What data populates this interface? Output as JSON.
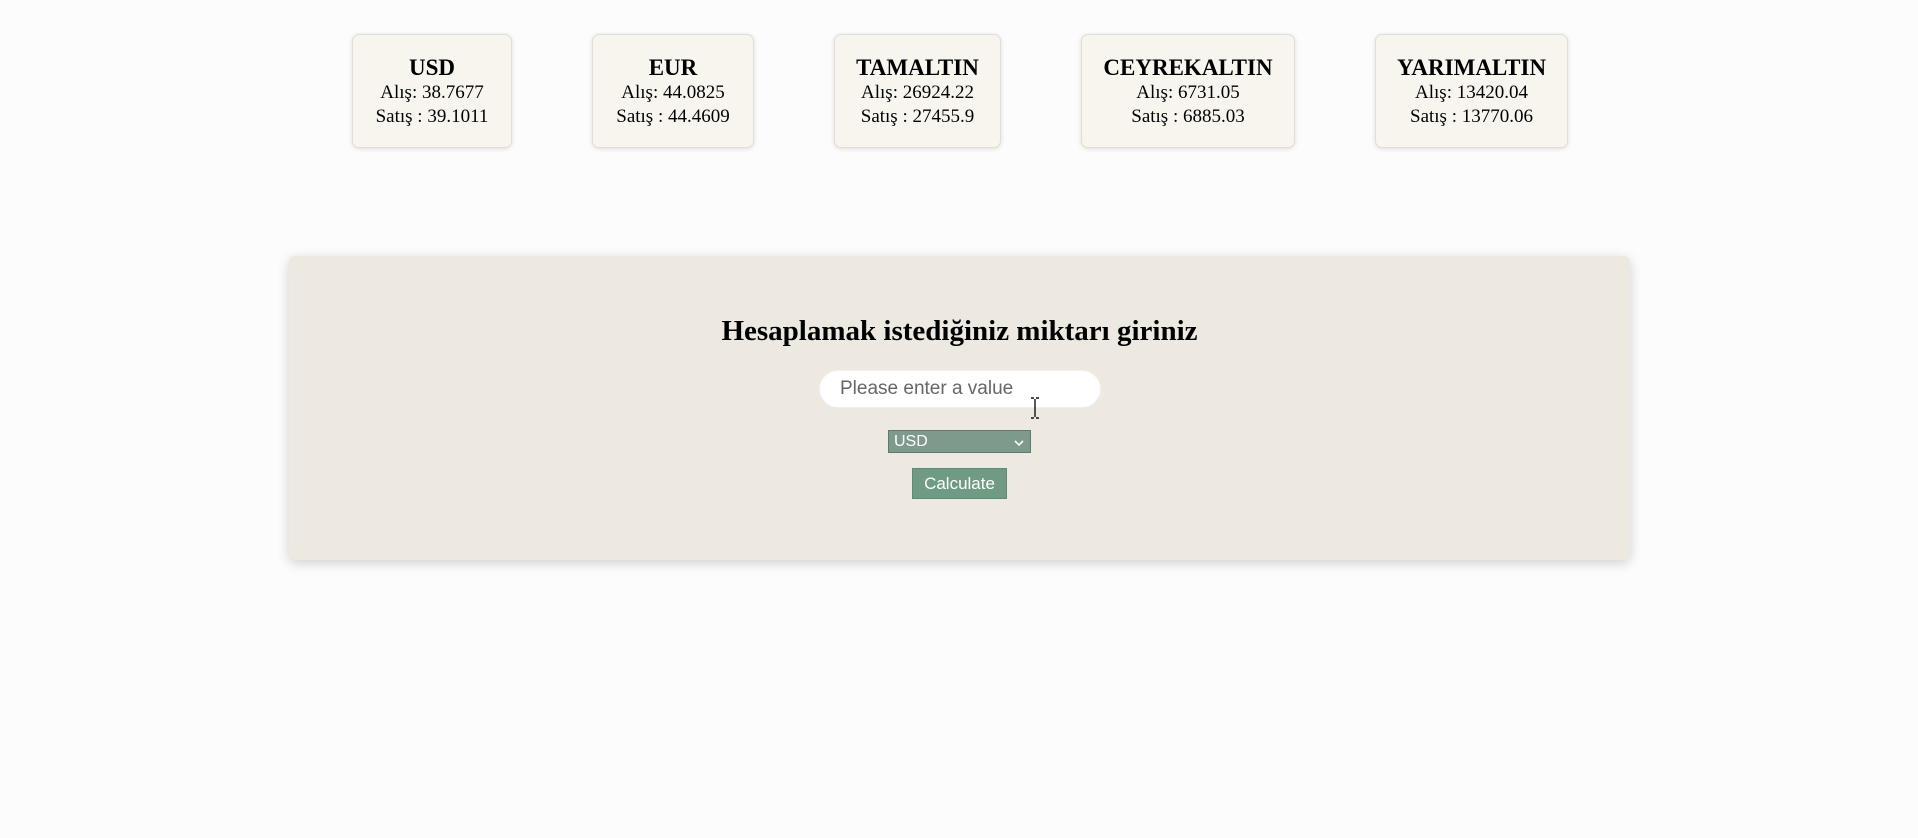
{
  "rates": [
    {
      "name": "USD",
      "buy": "Alış: 38.7677",
      "sell": "Satış : 39.1011"
    },
    {
      "name": "EUR",
      "buy": "Alış: 44.0825",
      "sell": "Satış : 44.4609"
    },
    {
      "name": "TAMALTIN",
      "buy": "Alış: 26924.22",
      "sell": "Satış : 27455.9"
    },
    {
      "name": "CEYREKALTIN",
      "buy": "Alış: 6731.05",
      "sell": "Satış : 6885.03"
    },
    {
      "name": "YARIMALTIN",
      "buy": "Alış: 13420.04",
      "sell": "Satış : 13770.06"
    }
  ],
  "calculator": {
    "title": "Hesaplamak istediğiniz miktarı giriniz",
    "input_placeholder": "Please enter a value",
    "input_value": "",
    "selected_currency": "USD",
    "button_label": "Calculate"
  },
  "icons": {
    "select_chevron": "chevron-down-icon",
    "cursor": "text-cursor-icon"
  },
  "colors": {
    "panel_bg": "#ede9e0",
    "card_bg": "#f7f5ee",
    "select_bg": "#7e9a8c",
    "button_bg": "#6f9b82"
  }
}
